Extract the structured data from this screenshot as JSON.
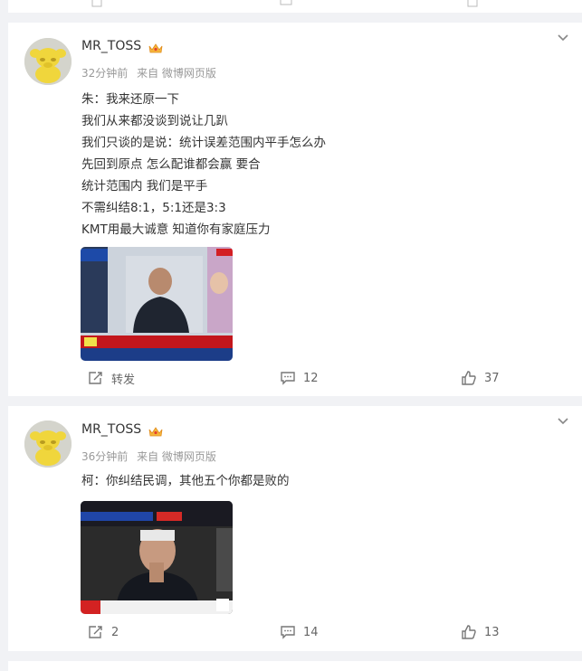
{
  "posts": [
    {
      "username": "MR_TOSS",
      "time": "32分钟前",
      "source": "来自 微博网页版",
      "lines": [
        "朱：我来还原一下",
        "我们从来都没谈到说让几趴",
        "我们只谈的是说：统计误差范围内平手怎么办",
        "先回到原点 怎么配谁都会赢 要合",
        "统计范围内 我们是平手",
        "不需纠结8:1，5:1还是3:3",
        "KMT用最大诚意 知道你有家庭压力"
      ],
      "repost_label": "转发",
      "comment_count": "12",
      "like_count": "37"
    },
    {
      "username": "MR_TOSS",
      "time": "36分钟前",
      "source": "来自 微博网页版",
      "lines": [
        "柯：你纠结民调，其他五个你都是败的"
      ],
      "repost_label": "2",
      "comment_count": "14",
      "like_count": "13"
    }
  ],
  "colors": {
    "background": "#f1f2f5",
    "card": "#ffffff",
    "text": "#333333",
    "meta": "#999999",
    "avatar_bg": "#d4d4cc",
    "mascot": "#f0d63c"
  },
  "icons": [
    "crown-icon",
    "chevron-down-icon",
    "repost-icon",
    "comment-icon",
    "like-icon"
  ]
}
